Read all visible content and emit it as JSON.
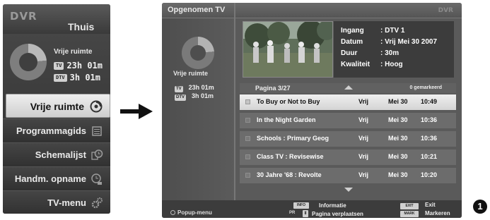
{
  "menu": {
    "logo": "DVR",
    "title": "Thuis",
    "space_title": "Vrije ruimte",
    "storage": [
      {
        "badge": "TV",
        "time": "23h 01m"
      },
      {
        "badge": "DTV",
        "time": "3h 01m"
      }
    ],
    "items": [
      {
        "label": "Vrije ruimte",
        "icon": "disc-icon",
        "active": true
      },
      {
        "label": "Programmagids",
        "icon": "guide-list-icon",
        "active": false
      },
      {
        "label": "Schemalijst",
        "icon": "clock-schedule-icon",
        "active": false
      },
      {
        "label": "Handm. opname",
        "icon": "manual-record-icon",
        "active": false
      },
      {
        "label": "TV-menu",
        "icon": "gears-icon",
        "active": false
      }
    ]
  },
  "screen": {
    "title": "Opgenomen TV",
    "logo": "DVR",
    "space_title": "Vrije ruimte",
    "storage": [
      {
        "badge": "TV",
        "time": "23h 01m"
      },
      {
        "badge": "DTV",
        "time": "3h 01m"
      }
    ],
    "info": {
      "ingang_k": "Ingang",
      "ingang_v": ": DTV 1",
      "datum_k": "Datum",
      "datum_v": ": Vrij Mei 30 2007",
      "duur_k": "Duur",
      "duur_v": ": 30m",
      "kwaliteit_k": "Kwaliteit",
      "kwaliteit_v": ": Hoog"
    },
    "page": "Pagina  3/27",
    "marked": "0 gemarkeerd",
    "recordings": [
      {
        "title": "To Buy or Not to Buy",
        "status": "Vrij",
        "date": "Mei 30",
        "time": "10:49",
        "selected": true
      },
      {
        "title": "In the Night Garden",
        "status": "Vrij",
        "date": "Mei 30",
        "time": "10:36",
        "selected": false
      },
      {
        "title": "Schools : Primary Geog",
        "status": "Vrij",
        "date": "Mei 30",
        "time": "10:36",
        "selected": false
      },
      {
        "title": "Class TV : Revisewise",
        "status": "Vrij",
        "date": "Mei 30",
        "time": "10:21",
        "selected": false
      },
      {
        "title": "30 Jahre '68 : Revolte",
        "status": "Vrij",
        "date": "Mei 30",
        "time": "10:20",
        "selected": false
      }
    ],
    "footer": {
      "popup": "Popup-menu",
      "info_key": "INFO",
      "info_label": "Informatie",
      "pr_key": "PR",
      "move_label": "Pagina verplaatsen",
      "exit_key": "EXIT",
      "exit_label": "Exit",
      "mark_key": "MARK",
      "mark_label": "Markeren"
    }
  },
  "step_number": "1"
}
